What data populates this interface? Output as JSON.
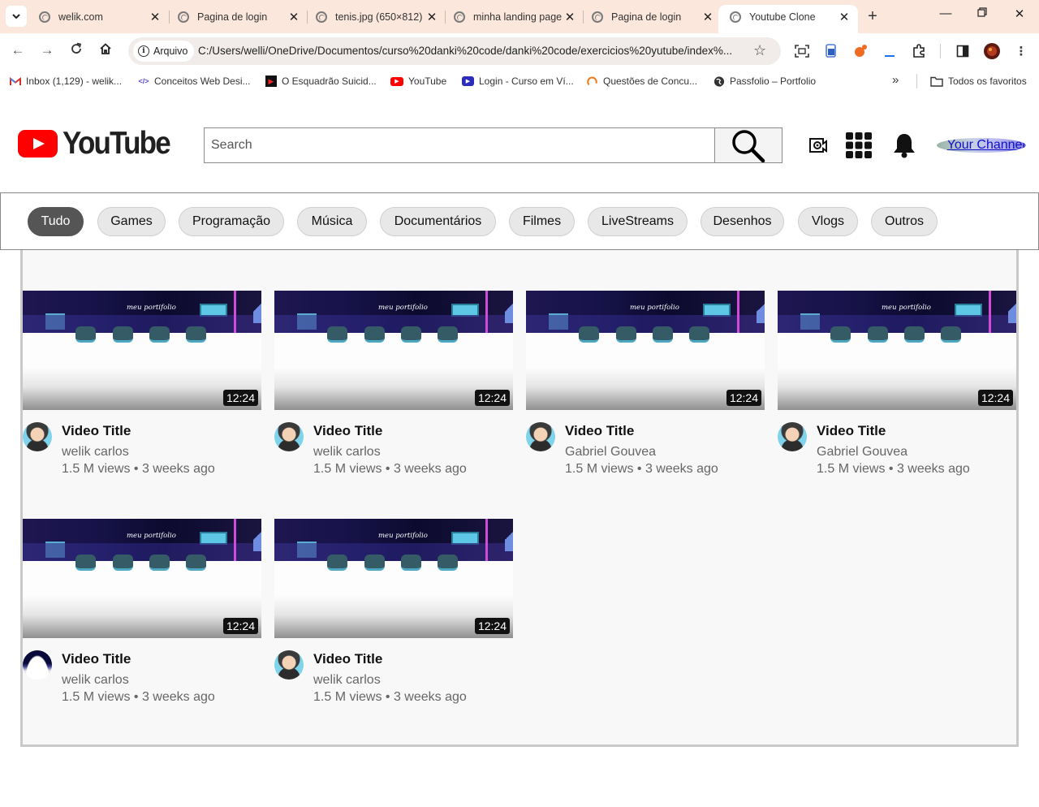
{
  "browser": {
    "tabs": [
      {
        "title": "welik.com",
        "active": false
      },
      {
        "title": "Pagina de login",
        "active": false
      },
      {
        "title": "tenis.jpg (650×812)",
        "active": false
      },
      {
        "title": "minha landing page",
        "active": false
      },
      {
        "title": "Pagina de login",
        "active": false
      },
      {
        "title": "Youtube Clone",
        "active": true
      }
    ],
    "site_chip": "Arquivo",
    "url": "C:/Users/welli/OneDrive/Documentos/curso%20danki%20code/danki%20code/exercicios%20yutube/index%...",
    "bookmarks": [
      {
        "label": "Inbox (1,129) - welik...",
        "icon": "gmail-icon"
      },
      {
        "label": "Conceitos Web Desi...",
        "icon": "code-icon"
      },
      {
        "label": "O Esquadrão Suicid...",
        "icon": "movie-icon"
      },
      {
        "label": "YouTube",
        "icon": "youtube-icon"
      },
      {
        "label": "Login - Curso em Ví...",
        "icon": "play-icon"
      },
      {
        "label": "Questões de Concu...",
        "icon": "q-icon"
      },
      {
        "label": "Passfolio – Portfolio",
        "icon": "globe-icon"
      }
    ],
    "more_bookmarks": "»",
    "all_bookmarks": "Todos os favoritos"
  },
  "header": {
    "logo_text": "YouTube",
    "search_placeholder": "Search",
    "channel_link": "Your Channel"
  },
  "chips": [
    "Tudo",
    "Games",
    "Programação",
    "Música",
    "Documentários",
    "Filmes",
    "LiveStreams",
    "Desenhos",
    "Vlogs",
    "Outros"
  ],
  "videos": [
    {
      "title": "Video Title",
      "channel": "welik carlos",
      "meta": "1.5 M views • 3 weeks ago",
      "duration": "12:24",
      "thumb_text": "meu portifolio",
      "avatar": "person"
    },
    {
      "title": "Video Title",
      "channel": "welik carlos",
      "meta": "1.5 M views • 3 weeks ago",
      "duration": "12:24",
      "thumb_text": "meu portifolio",
      "avatar": "person"
    },
    {
      "title": "Video Title",
      "channel": "Gabriel Gouvea",
      "meta": "1.5 M views • 3 weeks ago",
      "duration": "12:24",
      "thumb_text": "meu portifolio",
      "avatar": "person"
    },
    {
      "title": "Video Title",
      "channel": "Gabriel Gouvea",
      "meta": "1.5 M views • 3 weeks ago",
      "duration": "12:24",
      "thumb_text": "meu portifolio",
      "avatar": "person"
    },
    {
      "title": "Video Title",
      "channel": "welik carlos",
      "meta": "1.5 M views • 3 weeks ago",
      "duration": "12:24",
      "thumb_text": "meu portifolio",
      "avatar": "landscape"
    },
    {
      "title": "Video Title",
      "channel": "welik carlos",
      "meta": "1.5 M views • 3 weeks ago",
      "duration": "12:24",
      "thumb_text": "meu portifolio",
      "avatar": "person"
    }
  ],
  "colors": {
    "brand_red": "#ff0000",
    "active_chip": "#555555",
    "chip_bg": "#e8e8e8",
    "tabbar_bg": "#fbe7dc"
  }
}
